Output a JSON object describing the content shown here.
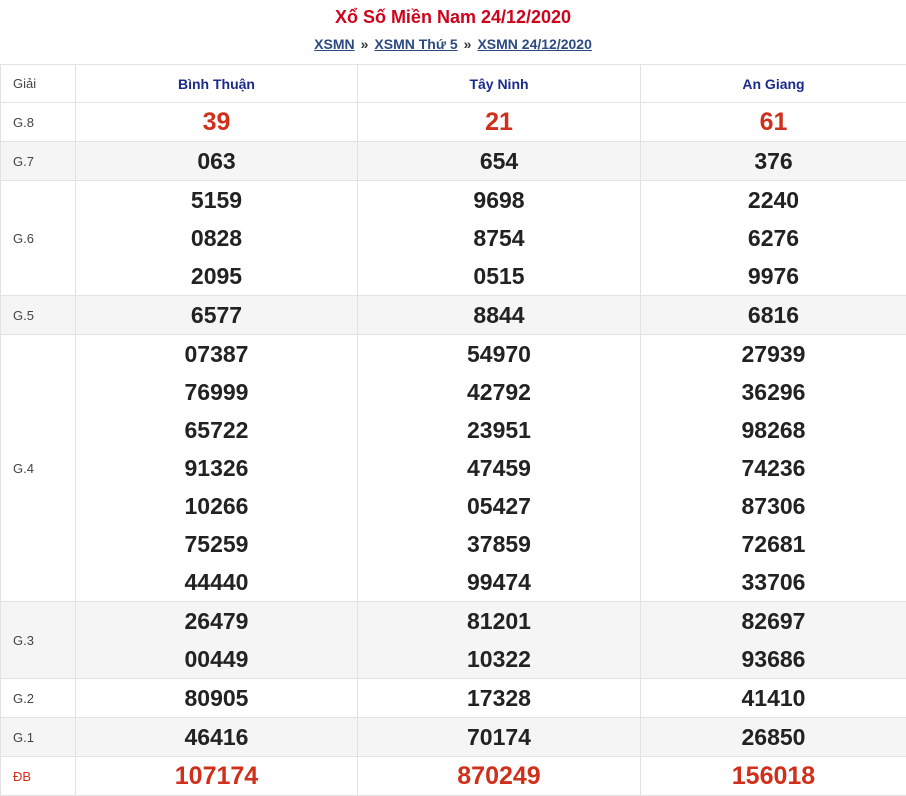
{
  "title": "Xổ Số Miền Nam 24/12/2020",
  "breadcrumb": [
    {
      "label": "XSMN"
    },
    {
      "label": "XSMN Thứ 5"
    },
    {
      "label": "XSMN 24/12/2020"
    }
  ],
  "breadcrumb_separator": "»",
  "header": {
    "prize_col": "Giải",
    "provinces": [
      "Bình Thuận",
      "Tây Ninh",
      "An Giang"
    ]
  },
  "rows": [
    {
      "label": "G.8",
      "values": [
        [
          "39"
        ],
        [
          "21"
        ],
        [
          "61"
        ]
      ]
    },
    {
      "label": "G.7",
      "values": [
        [
          "063"
        ],
        [
          "654"
        ],
        [
          "376"
        ]
      ]
    },
    {
      "label": "G.6",
      "values": [
        [
          "5159",
          "0828",
          "2095"
        ],
        [
          "9698",
          "8754",
          "0515"
        ],
        [
          "2240",
          "6276",
          "9976"
        ]
      ]
    },
    {
      "label": "G.5",
      "values": [
        [
          "6577"
        ],
        [
          "8844"
        ],
        [
          "6816"
        ]
      ]
    },
    {
      "label": "G.4",
      "values": [
        [
          "07387",
          "76999",
          "65722",
          "91326",
          "10266",
          "75259",
          "44440"
        ],
        [
          "54970",
          "42792",
          "23951",
          "47459",
          "05427",
          "37859",
          "99474"
        ],
        [
          "27939",
          "36296",
          "98268",
          "74236",
          "87306",
          "72681",
          "33706"
        ]
      ]
    },
    {
      "label": "G.3",
      "values": [
        [
          "26479",
          "00449"
        ],
        [
          "81201",
          "10322"
        ],
        [
          "82697",
          "93686"
        ]
      ]
    },
    {
      "label": "G.2",
      "values": [
        [
          "80905"
        ],
        [
          "17328"
        ],
        [
          "41410"
        ]
      ]
    },
    {
      "label": "G.1",
      "values": [
        [
          "46416"
        ],
        [
          "70174"
        ],
        [
          "26850"
        ]
      ]
    },
    {
      "label": "ĐB",
      "values": [
        [
          "107174"
        ],
        [
          "870249"
        ],
        [
          "156018"
        ]
      ]
    }
  ],
  "colors": {
    "accent_red": "#d0021b",
    "province_blue": "#1a2b8c",
    "link_blue": "#2b4a80"
  }
}
